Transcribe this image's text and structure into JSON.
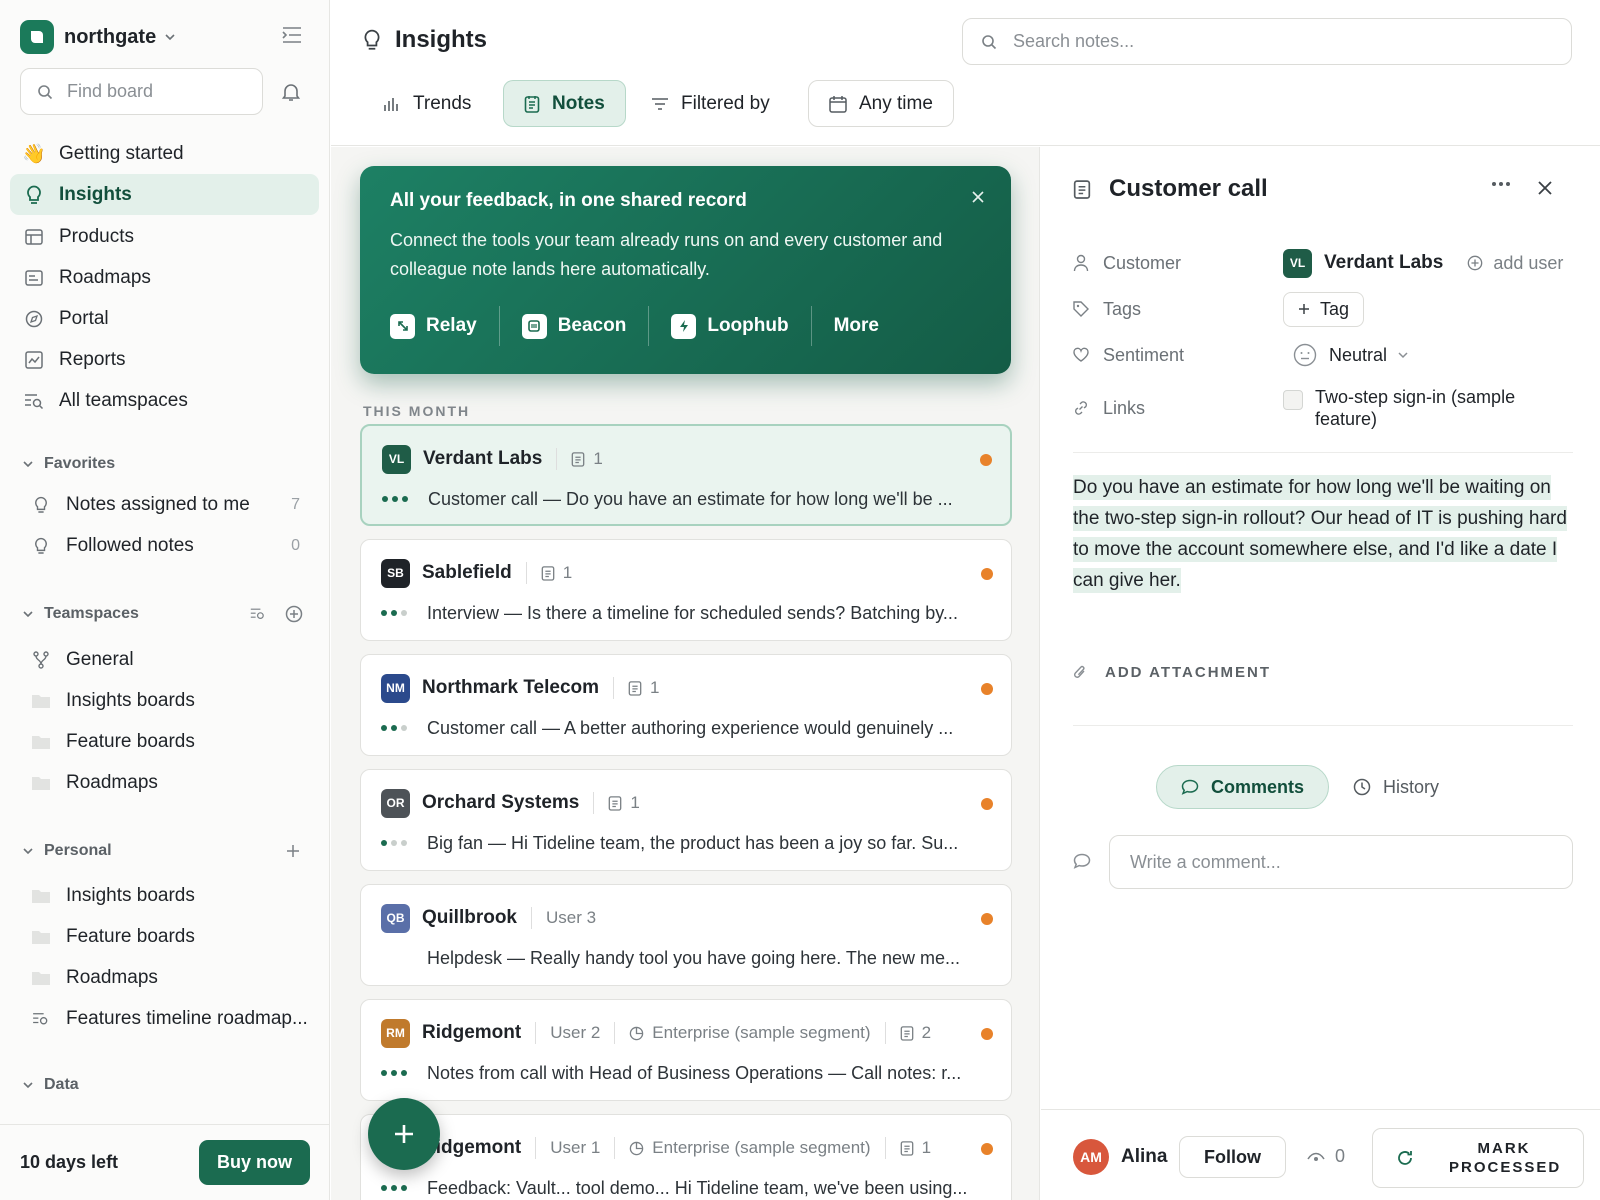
{
  "workspace": {
    "name": "northgate"
  },
  "sidebar": {
    "find_placeholder": "Find board",
    "nav": [
      {
        "label": "Getting started"
      },
      {
        "label": "Insights"
      },
      {
        "label": "Products"
      },
      {
        "label": "Roadmaps"
      },
      {
        "label": "Portal"
      },
      {
        "label": "Reports"
      },
      {
        "label": "All teamspaces"
      }
    ],
    "favorites": {
      "title": "Favorites",
      "items": [
        {
          "label": "Notes assigned to me",
          "count": "7"
        },
        {
          "label": "Followed notes",
          "count": "0"
        }
      ]
    },
    "teamspaces": {
      "title": "Teamspaces",
      "items": [
        {
          "label": "General"
        },
        {
          "label": "Insights boards"
        },
        {
          "label": "Feature boards"
        },
        {
          "label": "Roadmaps"
        }
      ]
    },
    "personal": {
      "title": "Personal",
      "items": [
        {
          "label": "Insights boards"
        },
        {
          "label": "Feature boards"
        },
        {
          "label": "Roadmaps"
        },
        {
          "label": "Features timeline roadmap..."
        }
      ]
    },
    "data": {
      "title": "Data"
    },
    "trial": {
      "text": "10 days left",
      "button": "Buy now"
    }
  },
  "header": {
    "title": "Insights",
    "search_placeholder": "Search notes...",
    "tabs": [
      {
        "label": "Trends"
      },
      {
        "label": "Notes"
      },
      {
        "label": "Filtered by"
      },
      {
        "label": "Any time"
      }
    ]
  },
  "banner": {
    "heading": "All your feedback, in one shared record",
    "description": "Connect the tools your team already runs on and every customer and colleague note lands here automatically.",
    "integrations": [
      {
        "label": "Relay"
      },
      {
        "label": "Beacon"
      },
      {
        "label": "Loophub"
      },
      {
        "label": "More"
      }
    ]
  },
  "list": {
    "section": "THIS MONTH",
    "cards": [
      {
        "initials": "VL",
        "color": "#1f5c47",
        "name": "Verdant Labs",
        "meta1": "",
        "meta2": "",
        "count": "1",
        "snippet": "Customer call — Do you have an estimate for how long we'll be ..."
      },
      {
        "initials": "SB",
        "color": "#1f2328",
        "name": "Sablefield",
        "meta1": "",
        "meta2": "",
        "count": "1",
        "snippet": "Interview — Is there a timeline for scheduled sends? Batching by..."
      },
      {
        "initials": "NM",
        "color": "#2b4a8c",
        "name": "Northmark Telecom",
        "meta1": "",
        "meta2": "",
        "count": "1",
        "snippet": "Customer call — A better authoring experience would genuinely ..."
      },
      {
        "initials": "OR",
        "color": "#4d5257",
        "name": "Orchard Systems",
        "meta1": "",
        "meta2": "",
        "count": "1",
        "snippet": "Big fan — Hi Tideline team, the product has been a joy so far. Su..."
      },
      {
        "initials": "QB",
        "color": "#5a6fa8",
        "name": "Quillbrook",
        "meta1": "User 3",
        "meta2": "",
        "count": "",
        "snippet": "Helpdesk — Really handy tool you have going here. The new me..."
      },
      {
        "initials": "RM",
        "color": "#c07a2c",
        "name": "Ridgemont",
        "meta1": "User 2",
        "meta2": "Enterprise (sample segment)",
        "count": "2",
        "snippet": "Notes from call with Head of Business Operations — Call notes: r..."
      },
      {
        "initials": "RM",
        "color": "#c07a2c",
        "name": "Ridgemont",
        "meta1": "User 1",
        "meta2": "Enterprise (sample segment)",
        "count": "1",
        "snippet": "Feedback: Vault... tool demo... Hi Tideline team, we've been using..."
      }
    ]
  },
  "detail": {
    "title": "Customer call",
    "customer_label": "Customer",
    "customer_initials": "VL",
    "customer_name": "Verdant Labs",
    "add_user": "add user",
    "tags_label": "Tags",
    "tag_button": "Tag",
    "sentiment_label": "Sentiment",
    "sentiment_value": "Neutral",
    "links_label": "Links",
    "link_value": "Two-step sign-in (sample feature)",
    "body": "Do you have an estimate for how long we'll be waiting on the two-step sign-in rollout? Our head of IT is pushing hard to move the account somewhere else, and I'd like a date I can give her.",
    "add_attachment": "ADD ATTACHMENT",
    "tabs": [
      {
        "label": "Comments"
      },
      {
        "label": "History"
      }
    ],
    "comment_placeholder": "Write a comment...",
    "footer": {
      "user_initials": "AM",
      "user_name": "Alina",
      "follow": "Follow",
      "watchers": "0",
      "mark": "MARK PROCESSED"
    }
  }
}
